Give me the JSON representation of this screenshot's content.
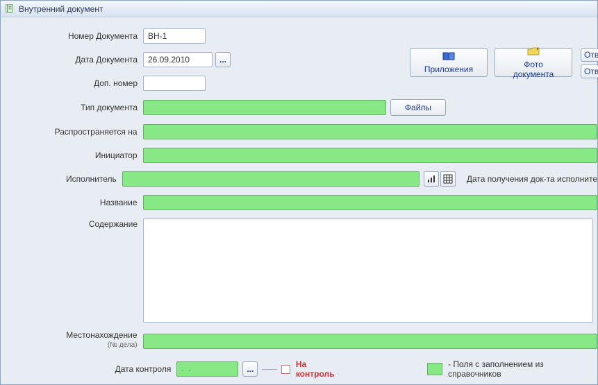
{
  "window": {
    "title": "Внутренний документ"
  },
  "labels": {
    "doc_number": "Номер Документа",
    "doc_date": "Дата Документа",
    "add_number": "Доп. номер",
    "doc_type": "Тип документа",
    "applies_to": "Распространяется на",
    "initiator": "Инициатор",
    "executor": "Исполнитель",
    "title_lbl": "Название",
    "content_lbl": "Содержание",
    "location": "Местонахождение",
    "location_sub": "(№ дела)",
    "control_date": "Дата контроля",
    "executor_date_note": "Дата получения док-та исполните",
    "on_control": "На контроль",
    "legend_text": "- Поля с заполнением из справочников"
  },
  "values": {
    "doc_number": "ВН-1",
    "doc_date": "26.09.2010",
    "add_number": "",
    "control_date_placeholder": ".  .",
    "doc_type": "",
    "applies_to": "",
    "initiator": "",
    "executor": "",
    "title_val": "",
    "content_val": "",
    "location": ""
  },
  "buttons": {
    "attachments": "Приложения",
    "doc_photo": "Фото документа",
    "files": "Файлы",
    "resp1": "Отв",
    "resp2": "Отв",
    "ellipsis": "..."
  }
}
